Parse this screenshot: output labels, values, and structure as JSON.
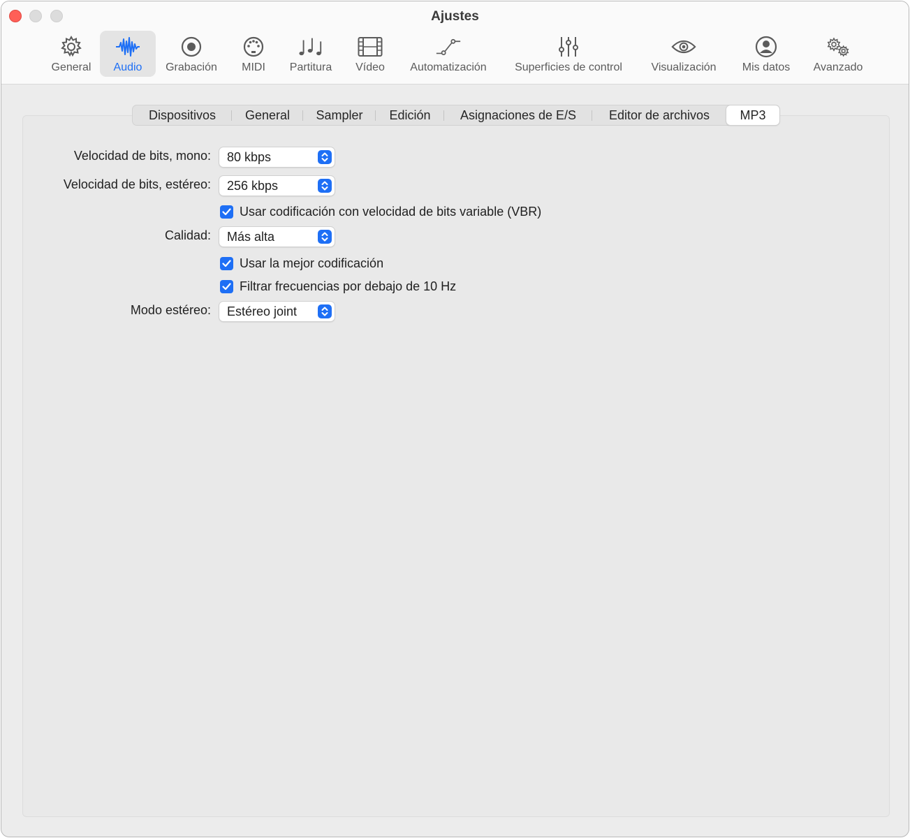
{
  "window": {
    "title": "Ajustes"
  },
  "toolbar": [
    {
      "label": "General",
      "icon": "gear-icon",
      "active": false
    },
    {
      "label": "Audio",
      "icon": "waveform-icon",
      "active": true
    },
    {
      "label": "Grabación",
      "icon": "record-icon",
      "active": false
    },
    {
      "label": "MIDI",
      "icon": "midi-port-icon",
      "active": false
    },
    {
      "label": "Partitura",
      "icon": "music-notes-icon",
      "active": false
    },
    {
      "label": "Vídeo",
      "icon": "film-icon",
      "active": false
    },
    {
      "label": "Automatización",
      "icon": "automation-curve-icon",
      "active": false
    },
    {
      "label": "Superficies de control",
      "icon": "sliders-icon",
      "active": false
    },
    {
      "label": "Visualización",
      "icon": "eye-icon",
      "active": false
    },
    {
      "label": "Mis datos",
      "icon": "person-icon",
      "active": false
    },
    {
      "label": "Avanzado",
      "icon": "gears-icon",
      "active": false
    }
  ],
  "tabs": [
    {
      "label": "Dispositivos",
      "active": false
    },
    {
      "label": "General",
      "active": false
    },
    {
      "label": "Sampler",
      "active": false
    },
    {
      "label": "Edición",
      "active": false
    },
    {
      "label": "Asignaciones de E/S",
      "active": false
    },
    {
      "label": "Editor de archivos",
      "active": false
    },
    {
      "label": "MP3",
      "active": true
    }
  ],
  "form": {
    "mono_label": "Velocidad de bits, mono:",
    "mono_value": "80 kbps",
    "stereo_label": "Velocidad de bits, estéreo:",
    "stereo_value": "256 kbps",
    "vbr_label": "Usar codificación con velocidad de bits variable (VBR)",
    "vbr_checked": true,
    "quality_label": "Calidad:",
    "quality_value": "Más alta",
    "best_label": "Usar la mejor codificación",
    "best_checked": true,
    "filter_label": "Filtrar frecuencias por debajo de 10 Hz",
    "filter_checked": true,
    "stereo_mode_label": "Modo estéreo:",
    "stereo_mode_value": "Estéreo joint"
  },
  "colors": {
    "accent": "#1e6ff5",
    "close": "#ff5f57"
  }
}
